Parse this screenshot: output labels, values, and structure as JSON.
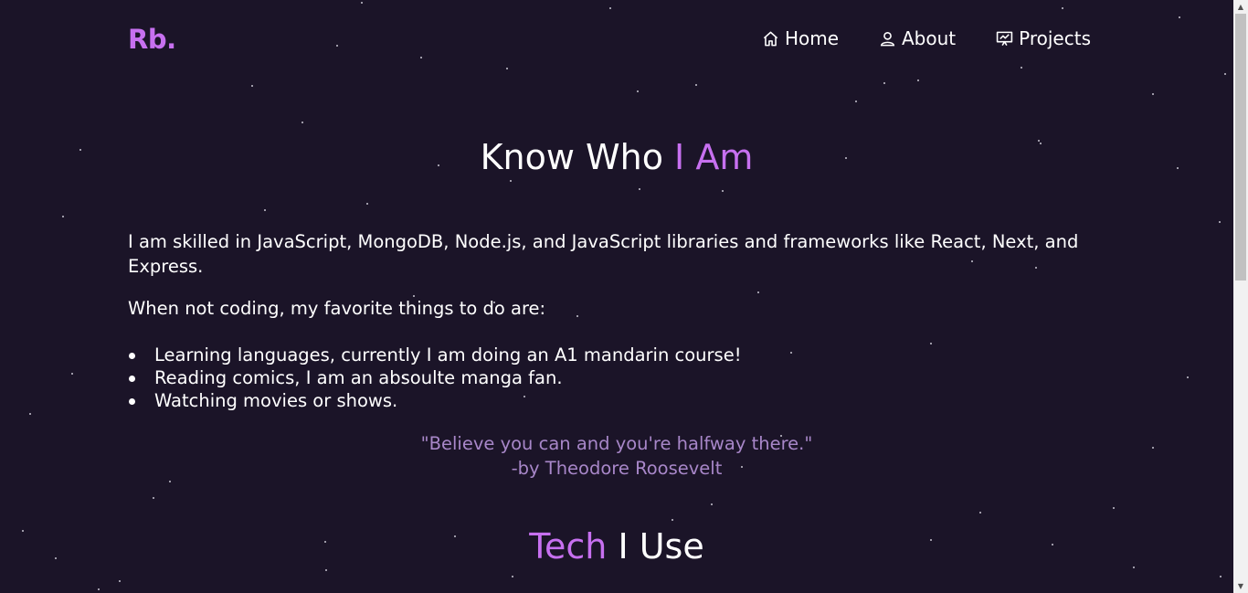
{
  "brand": {
    "logo": "Rb.",
    "accent_color": "#c770f0"
  },
  "nav": {
    "items": [
      {
        "label": "Home",
        "icon": "home-icon"
      },
      {
        "label": "About",
        "icon": "user-icon"
      },
      {
        "label": "Projects",
        "icon": "projects-icon"
      }
    ]
  },
  "about": {
    "heading_main": "Know Who ",
    "heading_accent": "I Am",
    "paragraph1": "I am skilled in JavaScript, MongoDB, Node.js, and JavaScript libraries and frameworks like React, Next, and Express.",
    "paragraph2": "When not coding, my favorite things to do are:",
    "hobbies": [
      "Learning languages, currently I am doing an A1 mandarin course!",
      "Reading comics, I am an absoulte manga fan.",
      "Watching movies or shows."
    ],
    "quote_text": "\"Believe you can and you're halfway there.\"",
    "quote_author": "-by Theodore Roosevelt"
  },
  "tech": {
    "heading_accent": "Tech",
    "heading_main": " I Use"
  },
  "colors": {
    "background": "#1b1428",
    "quote": "#a887c9"
  }
}
